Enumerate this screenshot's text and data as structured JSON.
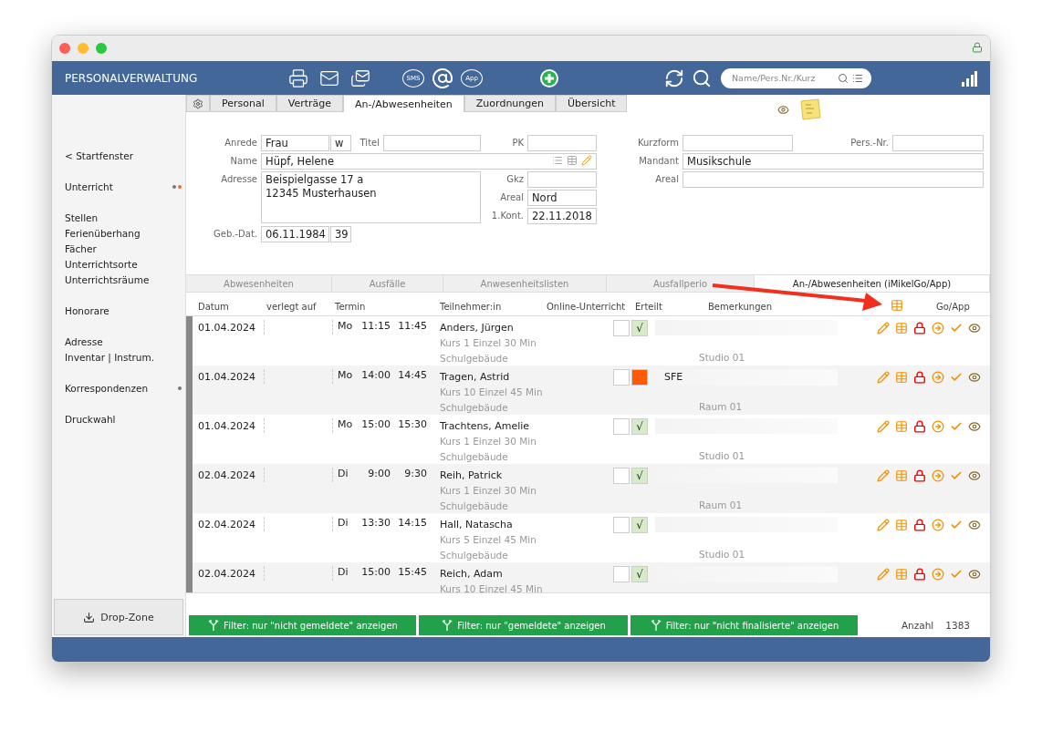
{
  "app": {
    "title": "PERSONALVERWALTUNG",
    "sms_label": "SMS",
    "app_label": "App",
    "search": {
      "placeholder": "Name/Pers.Nr./Kurz"
    }
  },
  "sidebar": {
    "groups": [
      {
        "items": [
          {
            "label": "< Startfenster"
          }
        ]
      },
      {
        "items": [
          {
            "label": "Unterricht",
            "dots": [
              {
                "color": "#777777"
              },
              {
                "color": "#f26b2a"
              }
            ]
          }
        ]
      },
      {
        "items": [
          {
            "label": "Stellen"
          },
          {
            "label": "Ferienüberhang"
          },
          {
            "label": "Fächer"
          },
          {
            "label": "Unterrichtsorte"
          },
          {
            "label": "Unterrichtsräume"
          }
        ]
      },
      {
        "items": [
          {
            "label": "Honorare"
          }
        ]
      },
      {
        "items": [
          {
            "label": "Adresse"
          },
          {
            "label": "Inventar | Instrum."
          }
        ]
      },
      {
        "items": [
          {
            "label": "Korrespondenzen",
            "dots": [
              {
                "color": "#777777"
              }
            ]
          }
        ]
      },
      {
        "items": [
          {
            "label": "Druckwahl"
          }
        ]
      }
    ],
    "drop_zone": "Drop-Zone"
  },
  "tabs": [
    {
      "label": "Personal",
      "selected": false
    },
    {
      "label": "Verträge",
      "selected": false
    },
    {
      "label": "An-/Abwesenheiten",
      "selected": true
    },
    {
      "label": "Zuordnungen",
      "selected": false
    },
    {
      "label": "Übersicht",
      "selected": false
    }
  ],
  "form": {
    "anrede": {
      "label": "Anrede",
      "value": "Frau",
      "gender": "w"
    },
    "titel": {
      "label": "Titel"
    },
    "pk": {
      "label": "PK"
    },
    "name": {
      "label": "Name",
      "value": "Hüpf, Helene"
    },
    "adresse": {
      "label": "Adresse",
      "value": "Beispielgasse 17 a\n12345 Musterhausen"
    },
    "gkz": {
      "label": "Gkz"
    },
    "areal": {
      "label": "Areal",
      "value": "Nord"
    },
    "kont": {
      "label": "1.Kont.",
      "value": "22.11.2018"
    },
    "geb": {
      "label": "Geb.-Dat.",
      "value": "06.11.1984",
      "age": "39"
    },
    "kurzform": {
      "label": "Kurzform"
    },
    "persnr": {
      "label": "Pers.-Nr."
    },
    "mandant": {
      "label": "Mandant",
      "value": "Musikschule"
    },
    "areal2": {
      "label": "Areal"
    }
  },
  "subtabs": [
    {
      "label": "Abwesenheiten",
      "selected": false
    },
    {
      "label": "Ausfälle",
      "selected": false
    },
    {
      "label": "Anwesenheitslisten",
      "selected": false
    },
    {
      "label": "Ausfallperio",
      "selected": false
    },
    {
      "label": "An-/Abwesenheiten (iMikelGo/App)",
      "selected": true
    }
  ],
  "table": {
    "columns": [
      "Datum",
      "verlegt auf",
      "Termin",
      "Teilnehmer:in",
      "Online-Unterricht",
      "Erteilt",
      "Bemerkungen",
      "Go/App"
    ],
    "rows": [
      {
        "date": "01.04.2024",
        "day": "Mo",
        "start": "11:15",
        "end": "11:45",
        "name": "Anders, Jürgen",
        "course": "Kurs 1 Einzel 30 Min",
        "place": "Schulgebäude",
        "room": "Studio 01",
        "online": false,
        "given": true,
        "given_mark": "√"
      },
      {
        "date": "01.04.2024",
        "day": "Mo",
        "start": "14:00",
        "end": "14:45",
        "name": "Tragen, Astrid",
        "course": "Kurs 10 Einzel 45 Min",
        "place": "Schulgebäude",
        "room": "Raum 01",
        "online": false,
        "given": false,
        "remark": "SFE"
      },
      {
        "date": "01.04.2024",
        "day": "Mo",
        "start": "15:00",
        "end": "15:30",
        "name": "Trachtens, Amelie",
        "course": "Kurs 1 Einzel 30 Min",
        "place": "Schulgebäude",
        "room": "Studio 01",
        "online": false,
        "given": true,
        "given_mark": "√"
      },
      {
        "date": "02.04.2024",
        "day": "Di",
        "start": "9:00",
        "end": "9:30",
        "name": "Reih, Patrick",
        "course": "Kurs 1 Einzel 30 Min",
        "place": "Schulgebäude",
        "room": "Raum 01",
        "online": false,
        "given": true,
        "given_mark": "√"
      },
      {
        "date": "02.04.2024",
        "day": "Di",
        "start": "13:30",
        "end": "14:15",
        "name": "Hall, Natascha",
        "course": "Kurs 5 Einzel 45 Min",
        "place": "Schulgebäude",
        "room": "Studio 01",
        "online": false,
        "given": true,
        "given_mark": "√"
      },
      {
        "date": "02.04.2024",
        "day": "Di",
        "start": "15:00",
        "end": "15:45",
        "name": "Reich, Adam",
        "course": "Kurs 10 Einzel 45 Min",
        "online": false,
        "given": true,
        "given_mark": "√"
      }
    ]
  },
  "filters": [
    "Filter: nur \"nicht gemeldete\" anzeigen",
    "Filter: nur \"gemeldete\" anzeigen",
    "Filter: nur \"nicht finalisierte\" anzeigen"
  ],
  "count": {
    "label": "Anzahl",
    "value": "1383"
  }
}
